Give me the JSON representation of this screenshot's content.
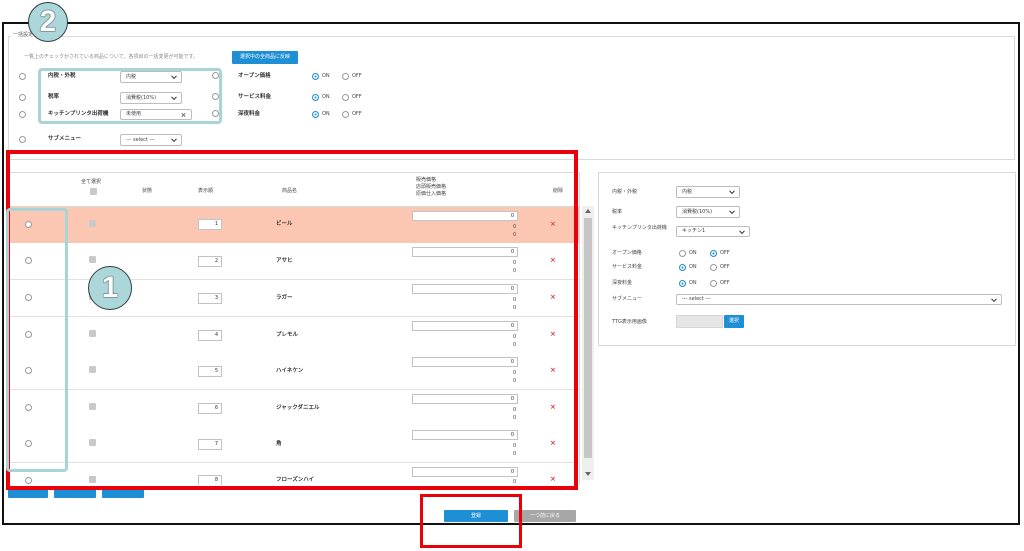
{
  "annotations": {
    "badge_1": "1",
    "badge_2": "2"
  },
  "bulk": {
    "title": "一括設定",
    "note": "一覧上のチェックがされている商品について、各項目の一括変更が可能です。",
    "apply_label": "選択中の全商品に反映",
    "fields": [
      {
        "label": "内税・外税",
        "value": "内税"
      },
      {
        "label": "税率",
        "value": "消費税(10%)"
      },
      {
        "label": "キッチンプリンタ出荷機",
        "value": "未使用"
      },
      {
        "label": "サブメニュー",
        "value": "--- select ---"
      }
    ],
    "toggles": [
      {
        "label": "オープン価格",
        "on_label": "ON",
        "off_label": "OFF",
        "on": true
      },
      {
        "label": "サービス料金",
        "on_label": "ON",
        "off_label": "OFF",
        "on": true
      },
      {
        "label": "深夜料金",
        "on_label": "ON",
        "off_label": "OFF",
        "on": true
      }
    ]
  },
  "table": {
    "headers": {
      "select_all": "全て選択",
      "status": "状態",
      "order": "表示順",
      "name": "商品名",
      "price_lines": [
        "販売価格",
        "店頭販売価格",
        "原価仕入価格"
      ],
      "delete": "削除"
    },
    "delete_icon": "×",
    "rows": [
      {
        "order": "1",
        "name": "ビール",
        "price": "0",
        "store_price": "0",
        "cost": "0"
      },
      {
        "order": "2",
        "name": "アサヒ",
        "price": "0",
        "store_price": "0",
        "cost": "0"
      },
      {
        "order": "3",
        "name": "ラガー",
        "price": "0",
        "store_price": "0",
        "cost": "0"
      },
      {
        "order": "4",
        "name": "プレモル",
        "price": "0",
        "store_price": "0",
        "cost": "0"
      },
      {
        "order": "5",
        "name": "ハイネケン",
        "price": "0",
        "store_price": "0",
        "cost": "0"
      },
      {
        "order": "6",
        "name": "ジャックダニエル",
        "price": "0",
        "store_price": "0",
        "cost": "0"
      },
      {
        "order": "7",
        "name": "角",
        "price": "0",
        "store_price": "0",
        "cost": "0"
      },
      {
        "order": "8",
        "name": "フローズンハイ",
        "price": "0",
        "store_price": "0"
      }
    ]
  },
  "footer": {
    "register_label": "登録",
    "back_label": "一つ前に戻る"
  },
  "detail": {
    "fields": [
      {
        "label": "内税・外税",
        "value": "内税"
      },
      {
        "label": "税率",
        "value": "消費税(10%)"
      },
      {
        "label": "キッチンプリンタ出荷機",
        "value": "キッチン1"
      }
    ],
    "toggles": [
      {
        "label": "オープン価格",
        "on_label": "ON",
        "off_label": "OFF",
        "on": false
      },
      {
        "label": "サービス料金",
        "on_label": "ON",
        "off_label": "OFF",
        "on": true
      },
      {
        "label": "深夜料金",
        "on_label": "ON",
        "off_label": "OFF",
        "on": true
      }
    ],
    "submenu": {
      "label": "サブメニュー",
      "value": "--- select ---"
    },
    "image": {
      "label": "TTG表示用画像",
      "button_label": "選択"
    }
  },
  "colors": {
    "accent": "#1e8fd5",
    "highlight_row": "#fbc7b3",
    "annotation_red": "#e8000b",
    "annotation_blue": "#a8d3d7"
  }
}
